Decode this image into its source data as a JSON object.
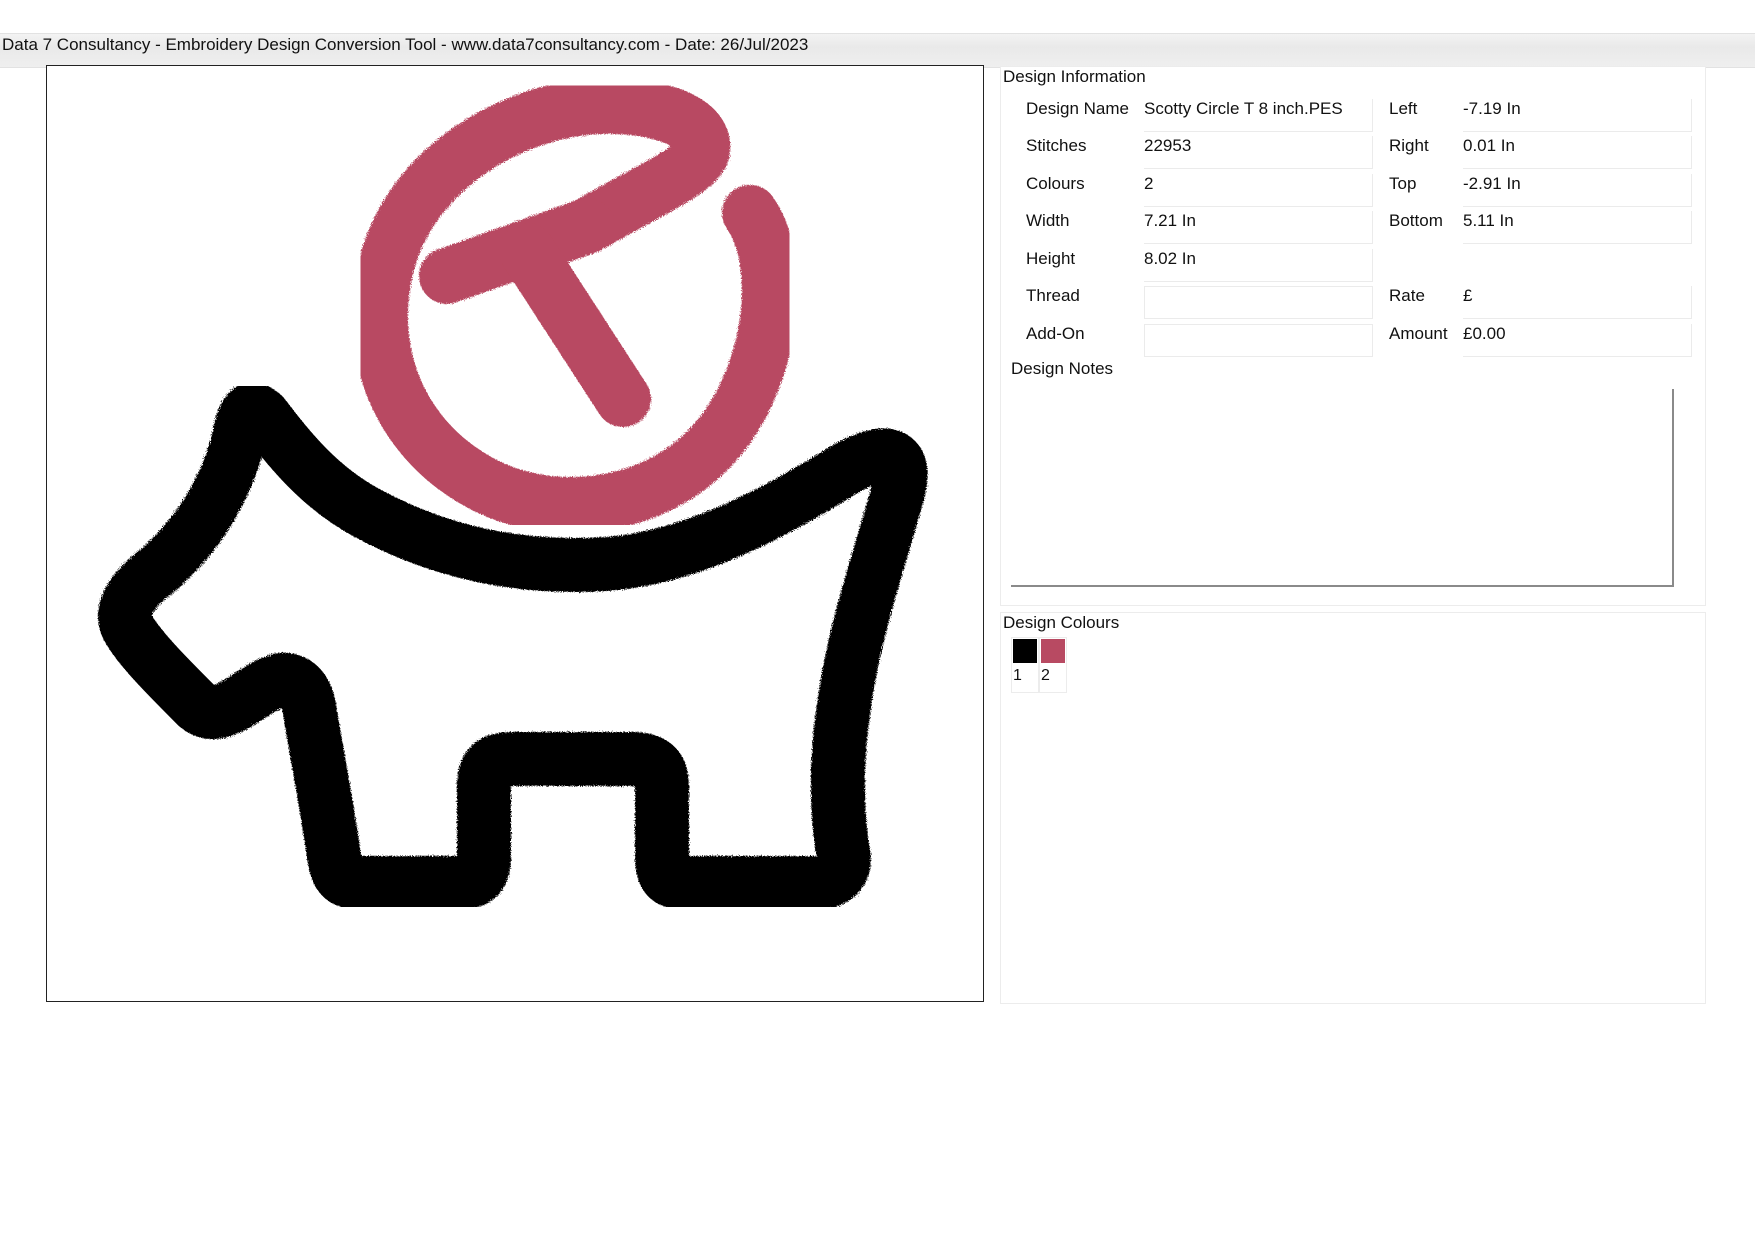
{
  "header": {
    "title": "Data 7 Consultancy - Embroidery Design Conversion Tool - www.data7consultancy.com - Date: 26/Jul/2023"
  },
  "preview": {
    "thread_colors": [
      "#000000",
      "#b84a62"
    ]
  },
  "design_info": {
    "title": "Design Information",
    "rows_left": [
      {
        "label": "Design Name",
        "value": "Scotty Circle T 8 inch.PES"
      },
      {
        "label": "Stitches",
        "value": "22953"
      },
      {
        "label": "Colours",
        "value": "2"
      },
      {
        "label": "Width",
        "value": "7.21 In"
      },
      {
        "label": "Height",
        "value": "8.02 In"
      },
      {
        "label": "Thread",
        "value": ""
      },
      {
        "label": "Add-On",
        "value": ""
      }
    ],
    "rows_right": [
      {
        "label": "Left",
        "value": "-7.19 In"
      },
      {
        "label": "Right",
        "value": "0.01 In"
      },
      {
        "label": "Top",
        "value": "-2.91 In"
      },
      {
        "label": "Bottom",
        "value": "5.11 In"
      },
      {
        "label": "Rate",
        "value": "£"
      },
      {
        "label": "Amount",
        "value": "£0.00"
      }
    ],
    "notes_label": "Design Notes",
    "notes_value": ""
  },
  "design_colours": {
    "title": "Design Colours",
    "swatches": [
      {
        "number": "1",
        "color": "#000000"
      },
      {
        "number": "2",
        "color": "#b84a62"
      }
    ]
  }
}
